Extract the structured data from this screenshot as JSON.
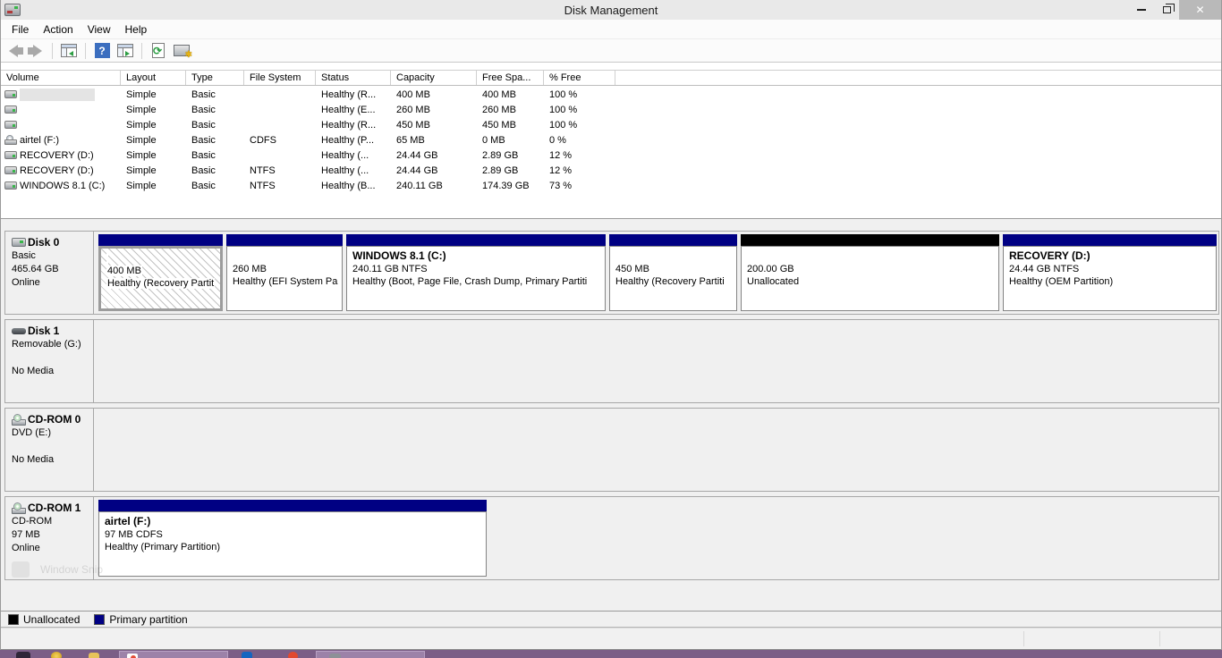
{
  "window": {
    "title": "Disk Management"
  },
  "menu": {
    "items": [
      "File",
      "Action",
      "View",
      "Help"
    ]
  },
  "volume_table": {
    "columns": [
      "Volume",
      "Layout",
      "Type",
      "File System",
      "Status",
      "Capacity",
      "Free Spa...",
      "% Free"
    ],
    "rows": [
      {
        "volume": "",
        "layout": "Simple",
        "type": "Basic",
        "fs": "",
        "status": "Healthy (R...",
        "capacity": "400 MB",
        "free_space": "400 MB",
        "pct_free": "100 %"
      },
      {
        "volume": "",
        "layout": "Simple",
        "type": "Basic",
        "fs": "",
        "status": "Healthy (E...",
        "capacity": "260 MB",
        "free_space": "260 MB",
        "pct_free": "100 %"
      },
      {
        "volume": "",
        "layout": "Simple",
        "type": "Basic",
        "fs": "",
        "status": "Healthy (R...",
        "capacity": "450 MB",
        "free_space": "450 MB",
        "pct_free": "100 %"
      },
      {
        "volume": "airtel (F:)",
        "layout": "Simple",
        "type": "Basic",
        "fs": "CDFS",
        "status": "Healthy (P...",
        "capacity": "65 MB",
        "free_space": "0 MB",
        "pct_free": "0 %"
      },
      {
        "volume": "RECOVERY (D:)",
        "layout": "Simple",
        "type": "Basic",
        "fs": "",
        "status": "Healthy (...",
        "capacity": "24.44 GB",
        "free_space": "2.89 GB",
        "pct_free": "12 %"
      },
      {
        "volume": "RECOVERY (D:)",
        "layout": "Simple",
        "type": "Basic",
        "fs": "NTFS",
        "status": "Healthy (...",
        "capacity": "24.44 GB",
        "free_space": "2.89 GB",
        "pct_free": "12 %"
      },
      {
        "volume": "WINDOWS 8.1 (C:)",
        "layout": "Simple",
        "type": "Basic",
        "fs": "NTFS",
        "status": "Healthy (B...",
        "capacity": "240.11 GB",
        "free_space": "174.39 GB",
        "pct_free": "73 %"
      }
    ]
  },
  "disks": [
    {
      "name": "Disk 0",
      "info": "Basic\n465.64 GB\nOnline",
      "partitions": [
        {
          "name": "",
          "size": "400 MB",
          "status": "Healthy (Recovery Partit",
          "strip": "#000083"
        },
        {
          "name": "",
          "size": "260 MB",
          "status": "Healthy (EFI System Pa",
          "strip": "#000083"
        },
        {
          "name": "WINDOWS 8.1  (C:)",
          "size": "240.11 GB NTFS",
          "status": "Healthy (Boot, Page File, Crash Dump, Primary Partiti",
          "strip": "#000083"
        },
        {
          "name": "",
          "size": "450 MB",
          "status": "Healthy (Recovery Partiti",
          "strip": "#000083"
        },
        {
          "name": "",
          "size": "200.00 GB",
          "status": "Unallocated",
          "strip": "#000000"
        },
        {
          "name": "RECOVERY  (D:)",
          "size": "24.44 GB NTFS",
          "status": "Healthy (OEM Partition)",
          "strip": "#000083"
        }
      ]
    },
    {
      "name": "Disk 1",
      "info": "Removable (G:)\n\nNo Media",
      "partitions": []
    },
    {
      "name": "CD-ROM 0",
      "info": "DVD (E:)\n\nNo Media",
      "partitions": []
    },
    {
      "name": "CD-ROM 1",
      "info": "CD-ROM\n97 MB\nOnline",
      "partitions": [
        {
          "name": "airtel  (F:)",
          "size": "97 MB CDFS",
          "status": "Healthy (Primary Partition)",
          "strip": "#000083"
        }
      ]
    }
  ],
  "legend": {
    "items": [
      {
        "label": "Unallocated",
        "color": "#000000"
      },
      {
        "label": "Primary partition",
        "color": "#000083"
      }
    ]
  },
  "ghost_text": "Window Snip",
  "colors": {
    "primary_partition": "#000083",
    "unallocated": "#000000",
    "taskbar": "#7b5e86"
  }
}
